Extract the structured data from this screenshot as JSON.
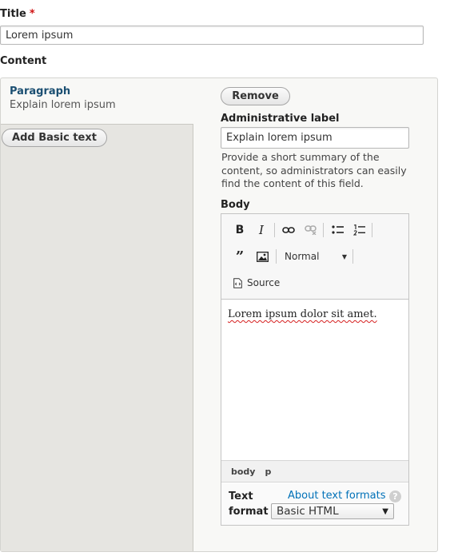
{
  "title_field": {
    "label": "Title",
    "required_marker": "*",
    "value": "Lorem ipsum"
  },
  "content_label": "Content",
  "paragraph": {
    "title": "Paragraph",
    "summary": "Explain lorem ipsum"
  },
  "add_basic_text_label": "Add Basic text",
  "remove_label": "Remove",
  "admin_label": {
    "label": "Administrative label",
    "value": "Explain lorem ipsum",
    "description": [
      "Provide a short summary of the",
      "content, so administrators can easily",
      "find the content of this field."
    ]
  },
  "body": {
    "label": "Body",
    "toolbar": {
      "bold": "B",
      "italic": "I",
      "heading_select": "Normal",
      "source": "Source"
    },
    "content": "Lorem ipsum dolor sit amet.",
    "path": {
      "body": "body",
      "p": "p"
    }
  },
  "text_format": {
    "label_line1": "Text",
    "label_line2": "format",
    "about_link": "About text formats",
    "help_glyph": "?",
    "selected": "Basic HTML"
  },
  "colors": {
    "accent_link": "#0071b8",
    "paragraph_title": "#1b4f72",
    "required": "#d01212",
    "left_panel_bg": "#e6e5e1"
  }
}
